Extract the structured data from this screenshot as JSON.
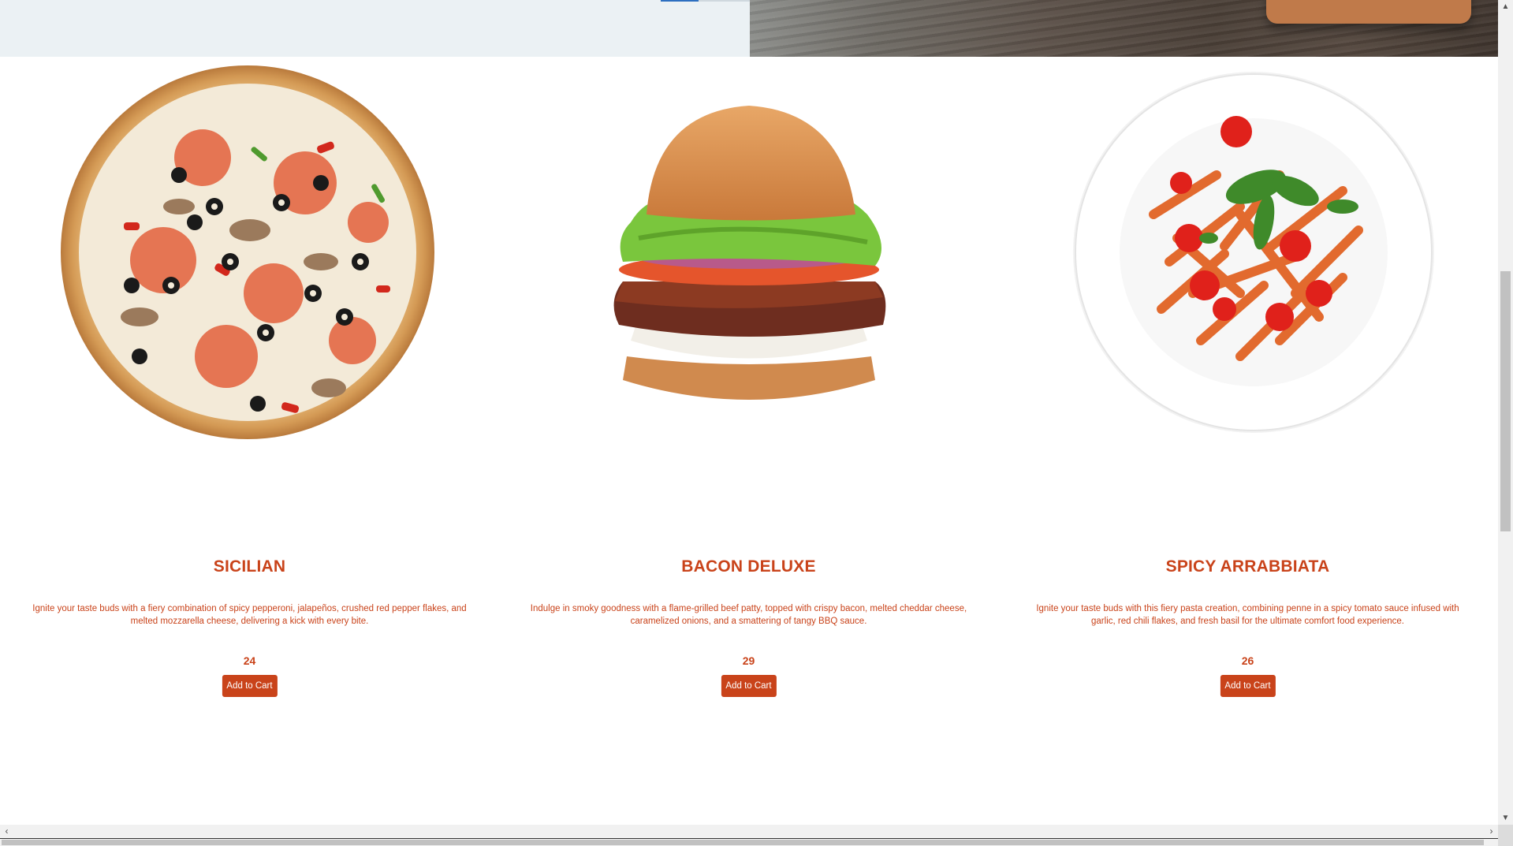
{
  "products": [
    {
      "name": "SICILIAN",
      "description": "Ignite your taste buds with a fiery combination of spicy pepperoni, jalapeños, crushed red pepper flakes, and melted mozzarella cheese, delivering a kick with every bite.",
      "price": "24",
      "button": "Add to Cart",
      "image_icon": "pizza-image"
    },
    {
      "name": "BACON DELUXE",
      "description": "Indulge in smoky goodness with a flame-grilled beef patty, topped with crispy bacon, melted cheddar cheese, caramelized onions, and a smattering of tangy BBQ sauce.",
      "price": "29",
      "button": "Add to Cart",
      "image_icon": "burger-image"
    },
    {
      "name": "SPICY ARRABBIATA",
      "description": "Ignite your taste buds with this fiery pasta creation, combining penne in a spicy tomato sauce infused with garlic, red chili flakes, and fresh basil for the ultimate comfort food experience.",
      "price": "26",
      "button": "Add to Cart",
      "image_icon": "pasta-image"
    }
  ],
  "colors": {
    "accent": "#c9431a",
    "hero_background": "#ebf1f4",
    "slider_active": "#2d6fc0"
  },
  "scrollbars": {
    "up_icon": "▲",
    "down_icon": "▼",
    "left_icon": "‹",
    "right_icon": "›"
  }
}
